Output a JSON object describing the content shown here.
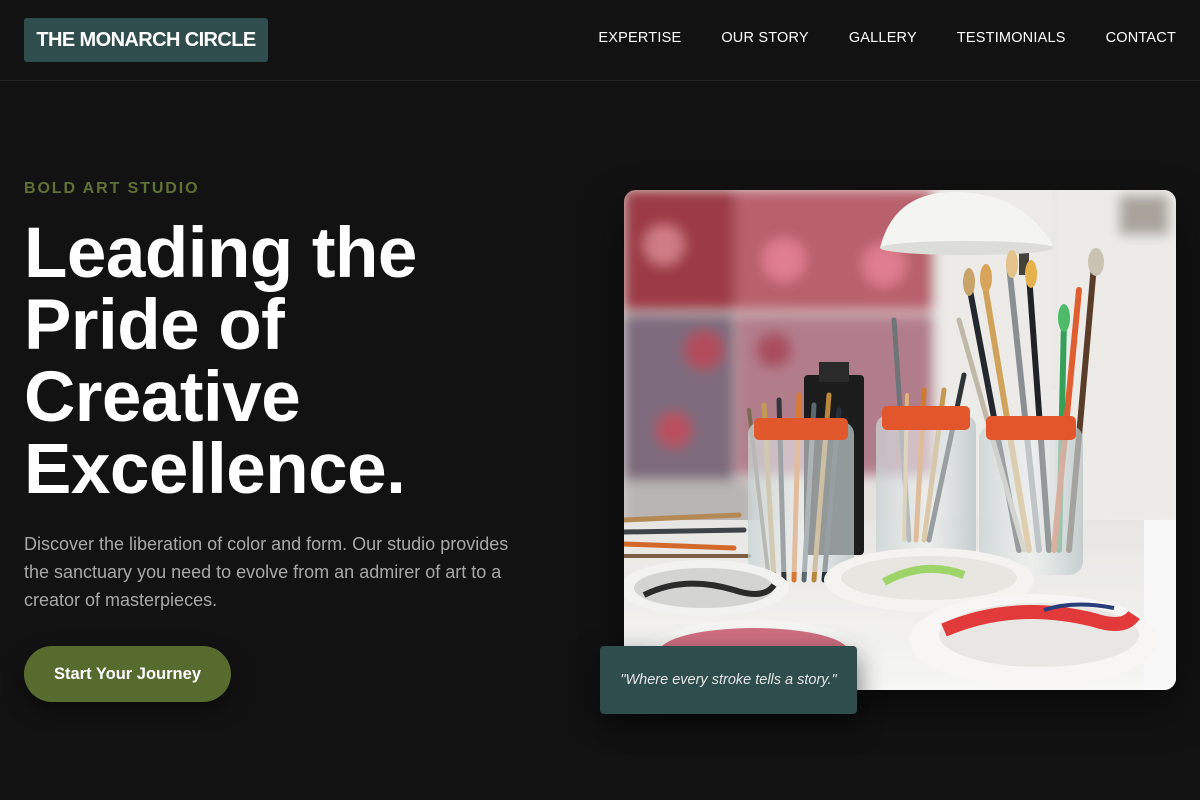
{
  "header": {
    "logo_text": "THE MONARCH CIRCLE",
    "nav": [
      {
        "label": "EXPERTISE"
      },
      {
        "label": "OUR STORY"
      },
      {
        "label": "GALLERY"
      },
      {
        "label": "TESTIMONIALS"
      },
      {
        "label": "CONTACT"
      }
    ]
  },
  "hero": {
    "eyebrow": "BOLD ART STUDIO",
    "headline_lines": [
      "Leading the",
      "Pride of",
      "Creative",
      "Excellence."
    ],
    "description": "Discover the liberation of color and form. Our studio provides the sanctuary you need to evolve from an admirer of art to a creator of masterpieces.",
    "cta_label": "Start Your Journey",
    "image_alt": "Paint brushes in glass jars with paint palettes on a studio table",
    "quote": "\"Where every stroke tells a story.\""
  },
  "colors": {
    "background": "#121212",
    "logo_bg": "#2f4d4d",
    "accent_olive": "#576b2f",
    "eyebrow": "#5e7236",
    "muted_text": "#a8a8a8"
  }
}
